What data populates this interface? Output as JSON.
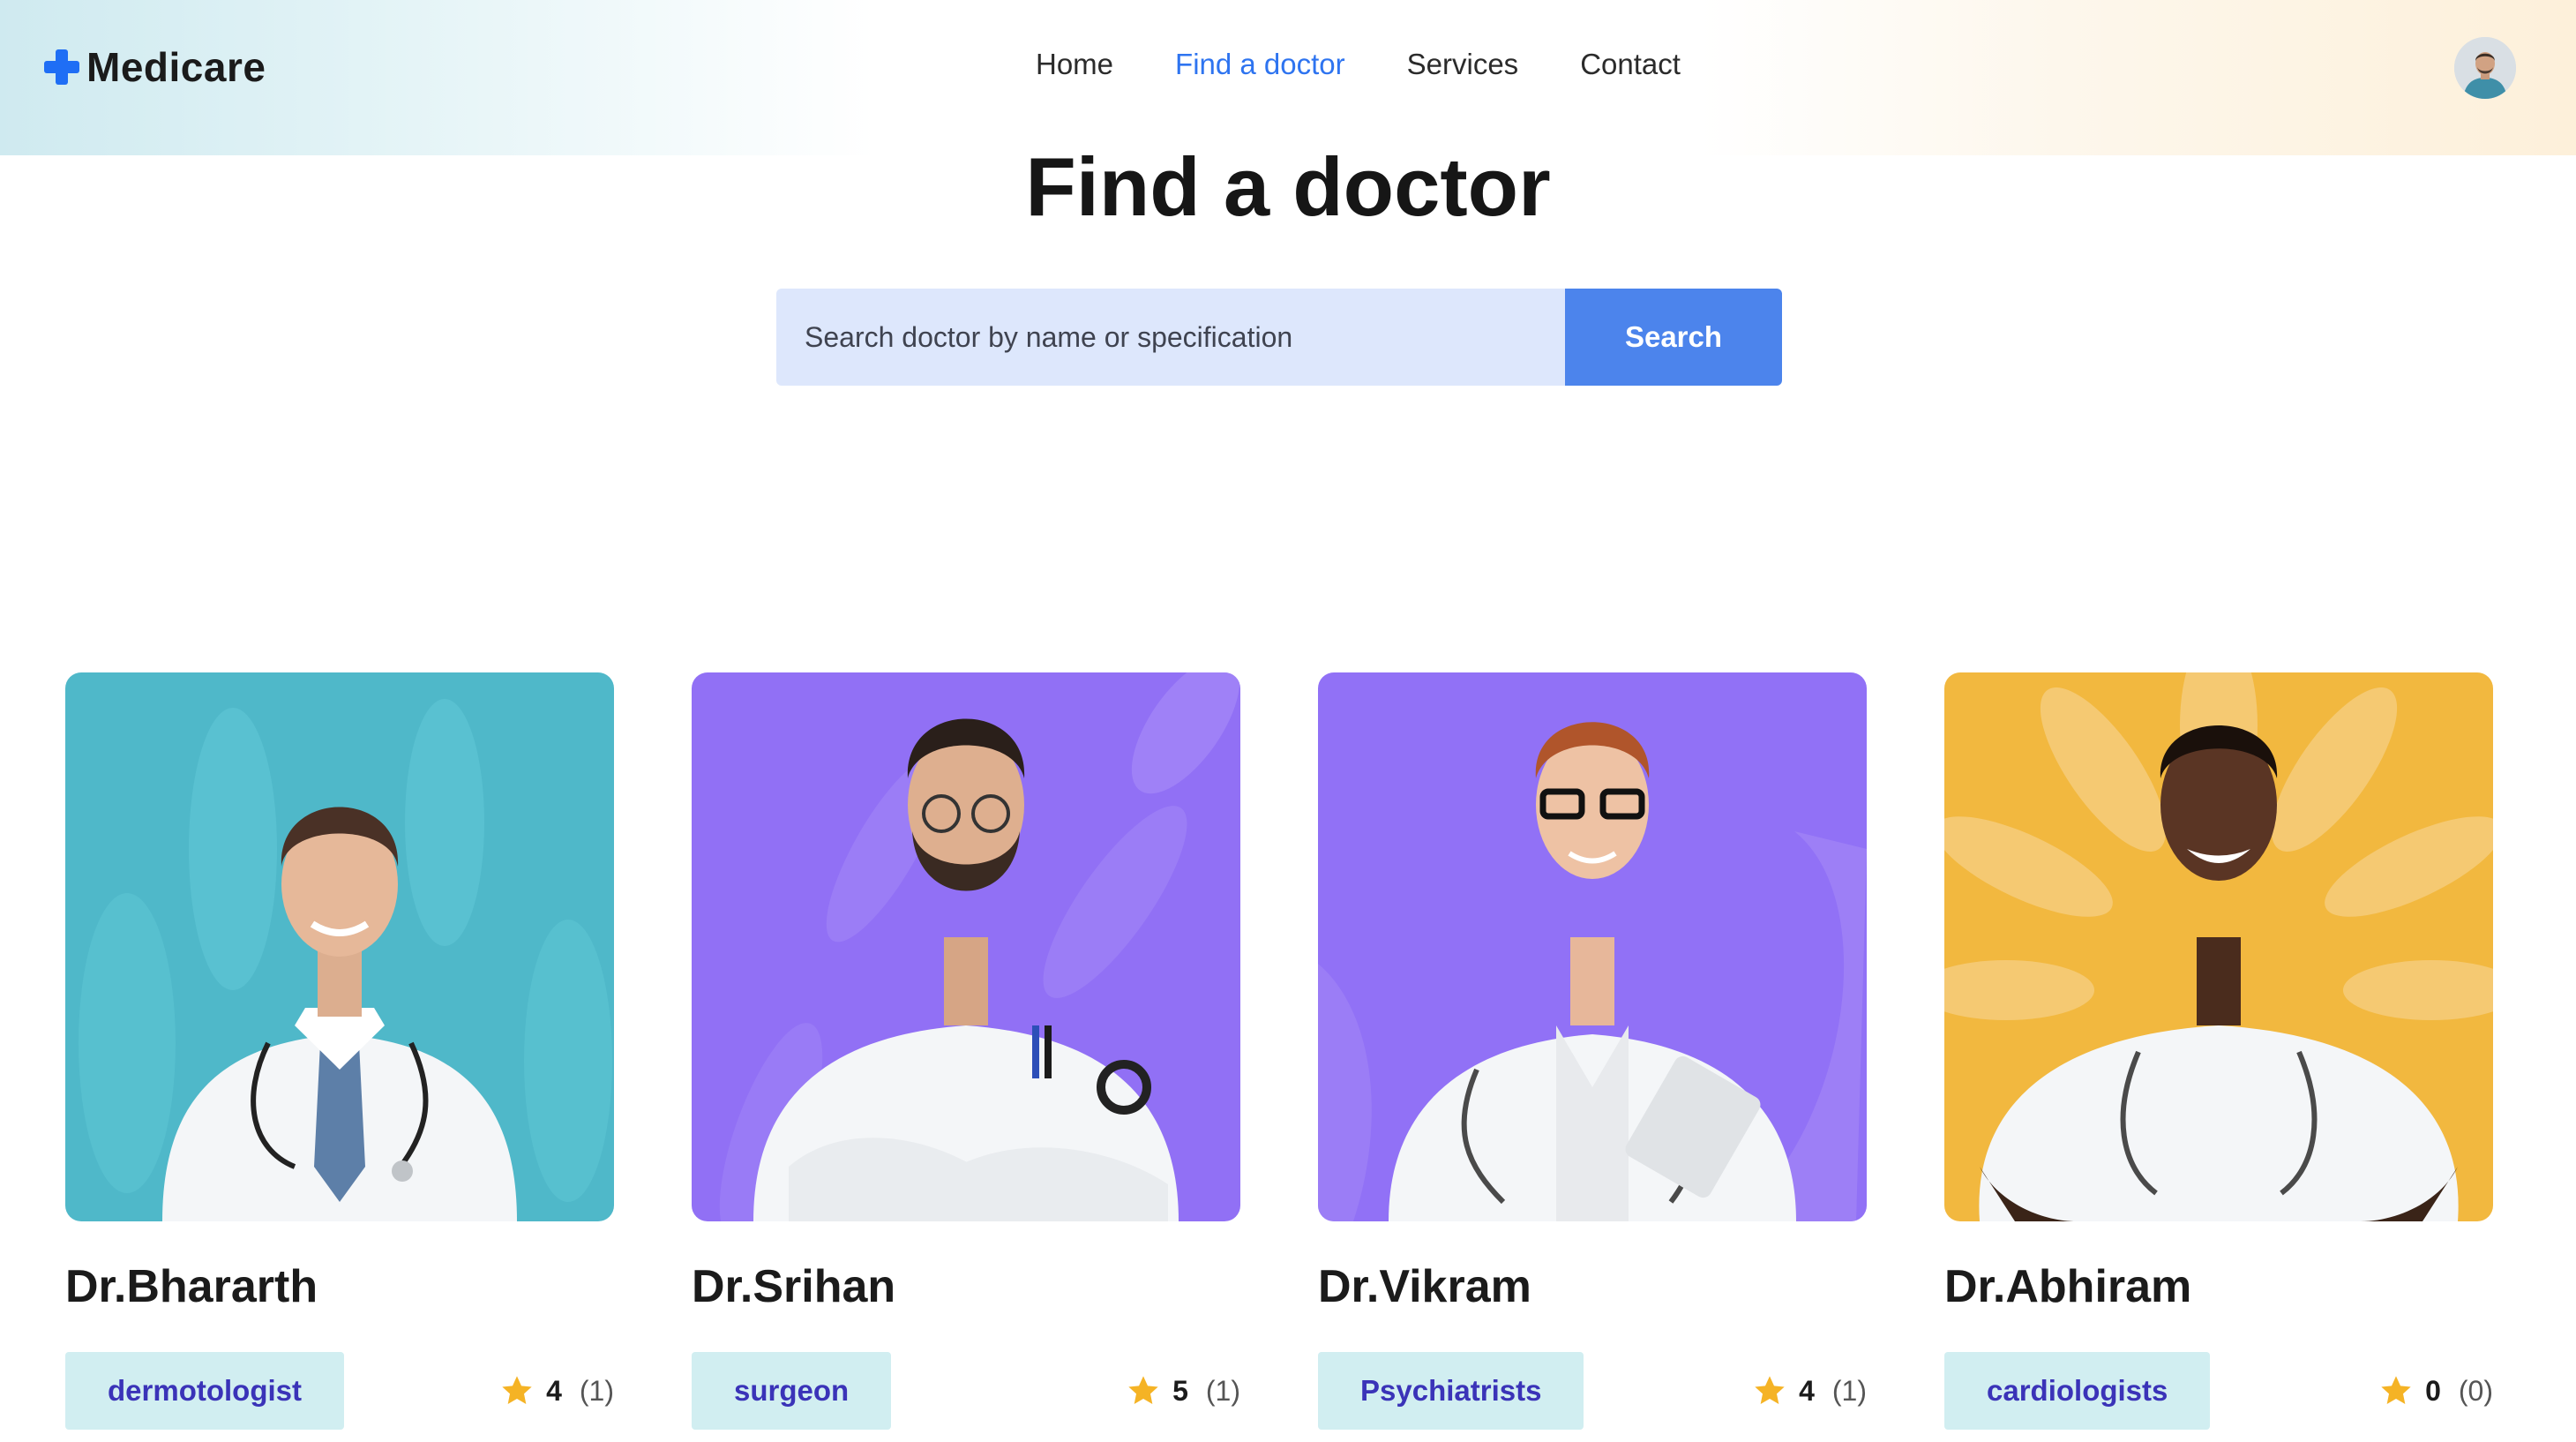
{
  "brand": {
    "name": "Medicare",
    "accent": "#1f6ef5"
  },
  "nav": {
    "items": [
      {
        "label": "Home",
        "active": false
      },
      {
        "label": "Find a doctor",
        "active": true
      },
      {
        "label": "Services",
        "active": false
      },
      {
        "label": "Contact",
        "active": false
      }
    ],
    "active_color": "#2e74f0"
  },
  "user": {
    "avatar_icon": "user-avatar"
  },
  "page": {
    "title": "Find a doctor"
  },
  "search": {
    "placeholder": "Search doctor by name or specification",
    "value": "",
    "button_label": "Search",
    "button_color": "#4c84ec",
    "input_bg": "#dde7fc"
  },
  "doctors": [
    {
      "name": "Dr.Bhararth",
      "specialization": "dermotologist",
      "avg_rating": "4",
      "total_ratings": "(1)",
      "bg_color": "#4fb8c9"
    },
    {
      "name": "Dr.Srihan",
      "specialization": "surgeon",
      "avg_rating": "5",
      "total_ratings": "(1)",
      "bg_color": "#9170f5"
    },
    {
      "name": "Dr.Vikram",
      "specialization": "Psychiatrists",
      "avg_rating": "4",
      "total_ratings": "(1)",
      "bg_color": "#9171f6"
    },
    {
      "name": "Dr.Abhiram",
      "specialization": "cardiologists",
      "avg_rating": "0",
      "total_ratings": "(0)",
      "bg_color": "#f2b83f"
    }
  ],
  "star_color": "#f5b325",
  "badge_bg": "#d1eef1",
  "badge_text_color": "#3a33b8"
}
